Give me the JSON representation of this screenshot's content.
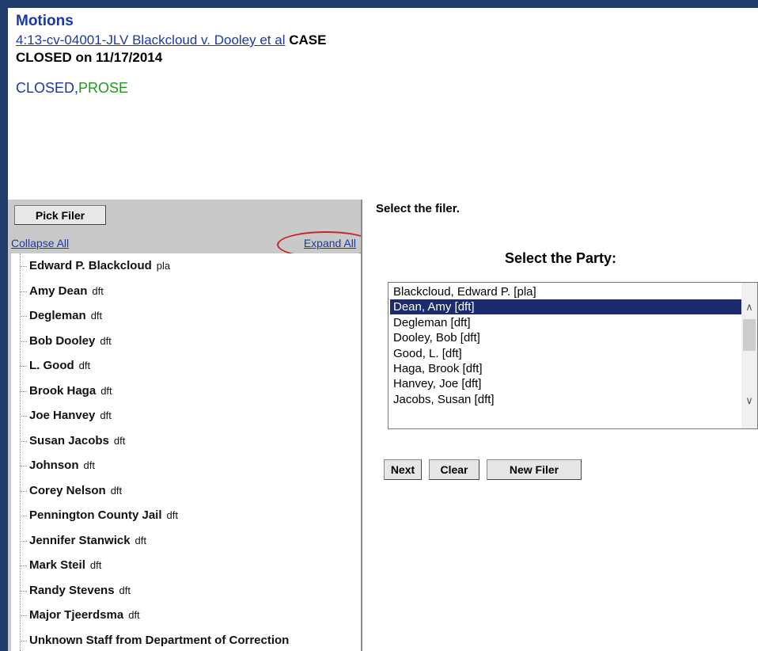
{
  "header": {
    "title": "Motions",
    "case_link": "4:13-cv-04001-JLV Blackcloud v. Dooley et al",
    "case_status": " CASE CLOSED on 11/17/2014",
    "flags": [
      "CLOSED",
      "PROSE"
    ],
    "flag_separator": ",",
    "flag_colors": {
      "CLOSED": "#1a39a6",
      "PROSE": "#1e9a1e"
    }
  },
  "left_panel": {
    "pick_filer_label": "Pick Filer",
    "collapse_all_label": "Collapse All",
    "expand_all_label": "Expand All",
    "tree_items": [
      {
        "name": "Edward P. Blackcloud",
        "role": "pla"
      },
      {
        "name": "Amy Dean",
        "role": "dft"
      },
      {
        "name": "Degleman",
        "role": "dft"
      },
      {
        "name": "Bob Dooley",
        "role": "dft"
      },
      {
        "name": "L. Good",
        "role": "dft"
      },
      {
        "name": "Brook Haga",
        "role": "dft"
      },
      {
        "name": "Joe Hanvey",
        "role": "dft"
      },
      {
        "name": "Susan Jacobs",
        "role": "dft"
      },
      {
        "name": "Johnson",
        "role": "dft"
      },
      {
        "name": "Corey Nelson",
        "role": "dft"
      },
      {
        "name": "Pennington County Jail",
        "role": "dft"
      },
      {
        "name": "Jennifer Stanwick",
        "role": "dft"
      },
      {
        "name": "Mark Steil",
        "role": "dft"
      },
      {
        "name": "Randy Stevens",
        "role": "dft"
      },
      {
        "name": "Major Tjeerdsma",
        "role": "dft"
      },
      {
        "name": "Unknown Staff from Department of Correction",
        "role": ""
      }
    ]
  },
  "right_panel": {
    "select_filer_heading": "Select the filer.",
    "party_heading": "Select the Party:",
    "party_options": [
      "Blackcloud, Edward P.  [pla]",
      "Dean, Amy  [dft]",
      "Degleman  [dft]",
      "Dooley, Bob  [dft]",
      "Good, L.  [dft]",
      "Haga, Brook  [dft]",
      "Hanvey, Joe  [dft]",
      "Jacobs, Susan  [dft]"
    ],
    "selected_option": "Dean, Amy  [dft]",
    "scroll_up_icon": "chevron-up-icon",
    "scroll_down_icon": "chevron-down-icon",
    "buttons": {
      "next": "Next",
      "clear": "Clear",
      "new_filer": "New Filer"
    }
  },
  "colors": {
    "frame": "#1f3d6b",
    "link": "#1a39a6",
    "selection": "#1b2b6b",
    "highlight_ring": "#c8242a",
    "panel_bg": "#c9c9c9"
  }
}
